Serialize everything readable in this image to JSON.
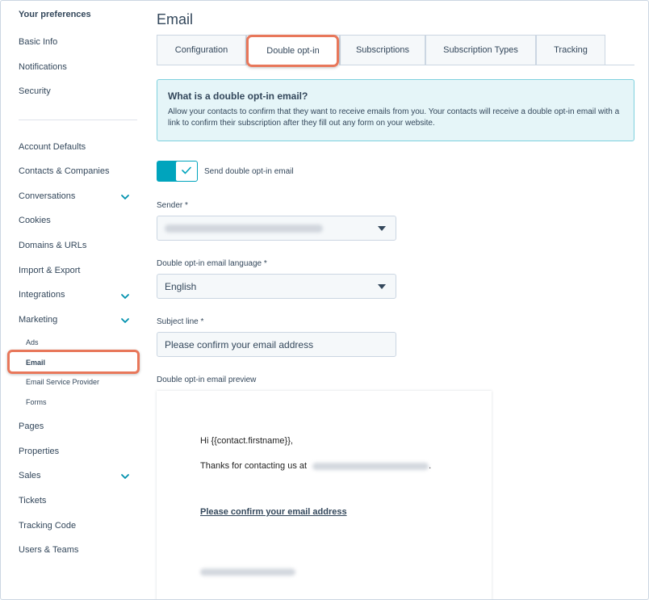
{
  "sidebar": {
    "heading": "Your preferences",
    "top_items": [
      "Basic Info",
      "Notifications",
      "Security"
    ],
    "items": [
      {
        "label": "Account Defaults"
      },
      {
        "label": "Contacts & Companies"
      },
      {
        "label": "Conversations",
        "icon": "chevron-down-icon"
      },
      {
        "label": "Cookies"
      },
      {
        "label": "Domains & URLs"
      },
      {
        "label": "Import & Export"
      },
      {
        "label": "Integrations",
        "icon": "chevron-down-icon"
      },
      {
        "label": "Marketing",
        "icon": "chevron-down-icon"
      }
    ],
    "marketing_sub": [
      "Ads",
      "Email",
      "Email Service Provider",
      "Forms"
    ],
    "bottom_items": [
      {
        "label": "Pages"
      },
      {
        "label": "Properties"
      },
      {
        "label": "Sales",
        "icon": "chevron-down-icon"
      },
      {
        "label": "Tickets"
      },
      {
        "label": "Tracking Code"
      },
      {
        "label": "Users & Teams"
      }
    ]
  },
  "main": {
    "title": "Email",
    "tabs": [
      "Configuration",
      "Double opt-in",
      "Subscriptions",
      "Subscription Types",
      "Tracking"
    ],
    "active_tab": "Double opt-in",
    "info": {
      "heading": "What is a double opt-in email?",
      "body": "Allow your contacts to confirm that they want to receive emails from you. Your contacts will receive a double opt-in email with a link to confirm their subscription after they fill out any form on your website."
    },
    "toggle": {
      "label": "Send double opt-in email",
      "on": true
    },
    "sender": {
      "label": "Sender *"
    },
    "language": {
      "label": "Double opt-in email language  *",
      "value": "English"
    },
    "subject": {
      "label": "Subject line *",
      "value": "Please confirm your email address"
    },
    "preview": {
      "label": "Double opt-in email preview",
      "greeting": "Hi {{contact.firstname}},",
      "thanks": "Thanks for contacting us at",
      "period": ".",
      "link": "Please confirm your email address"
    }
  },
  "colors": {
    "accent": "#00a4bd",
    "highlight": "#e8775a",
    "info_bg": "#e5f5f8",
    "text": "#33475b"
  }
}
